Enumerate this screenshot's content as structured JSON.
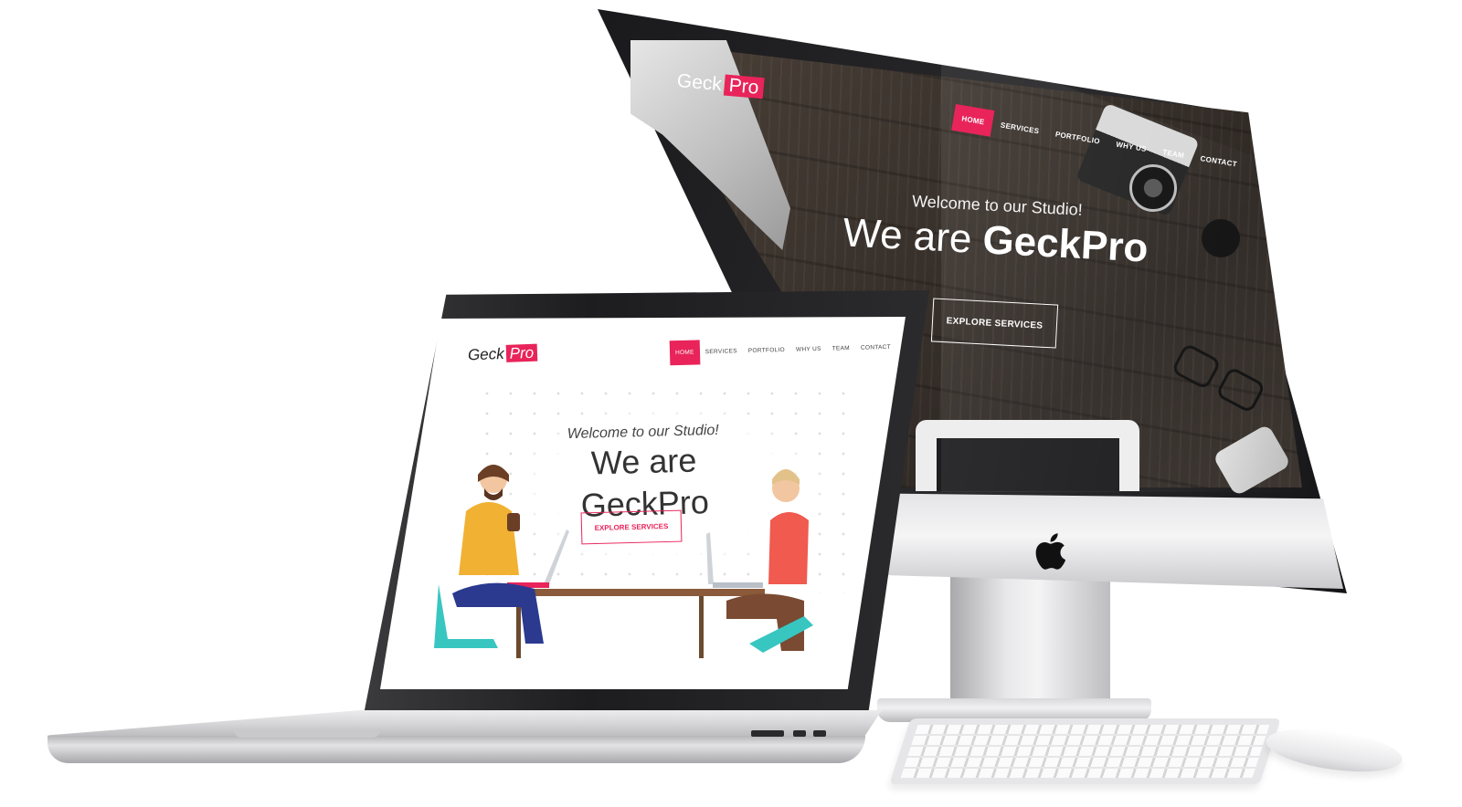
{
  "imac": {
    "brand": {
      "part1": "Geck",
      "part2": "Pro"
    },
    "nav": [
      "HOME",
      "SERVICES",
      "PORTFOLIO",
      "WHY US",
      "TEAM",
      "CONTACT"
    ],
    "hero": {
      "welcome": "Welcome to our Studio!",
      "title_light": "We are",
      "title_bold": "GeckPro"
    },
    "cta": "EXPLORE SERVICES"
  },
  "macbook": {
    "brand": {
      "part1": "Geck",
      "part2": "Pro"
    },
    "nav": [
      "HOME",
      "SERVICES",
      "PORTFOLIO",
      "WHY US",
      "TEAM",
      "CONTACT"
    ],
    "hero": {
      "welcome": "Welcome to our Studio!",
      "title": "We are GeckPro"
    },
    "cta": "EXPLORE SERVICES"
  },
  "colors": {
    "accent": "#e8245a",
    "wood_dark": "#3a322c",
    "device_silver": "#e4e4e6"
  },
  "icons": [
    "apple-logo-icon"
  ]
}
